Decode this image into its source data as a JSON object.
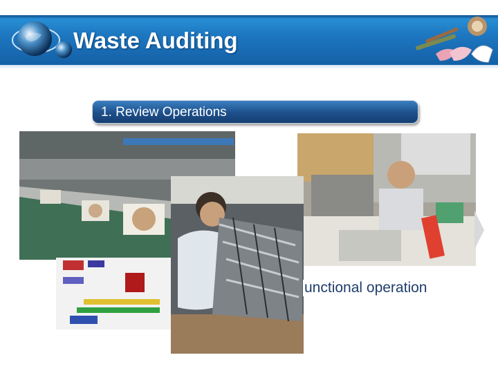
{
  "header": {
    "title": "Waste Auditing"
  },
  "subtitle": {
    "text": "1. Review Operations"
  },
  "caption": {
    "text": "unctional operation"
  },
  "colors": {
    "header_blue": "#1d77c0",
    "subtitle_blue": "#1d4f8a",
    "caption_text": "#1f3d6b"
  },
  "icons": {
    "logo": "globe-logo-icon",
    "tools": "hand-tools-image"
  },
  "photos": [
    "assembly-line-photo",
    "office-worker-photo",
    "process-chart-image",
    "worker-sorting-parts-photo"
  ]
}
